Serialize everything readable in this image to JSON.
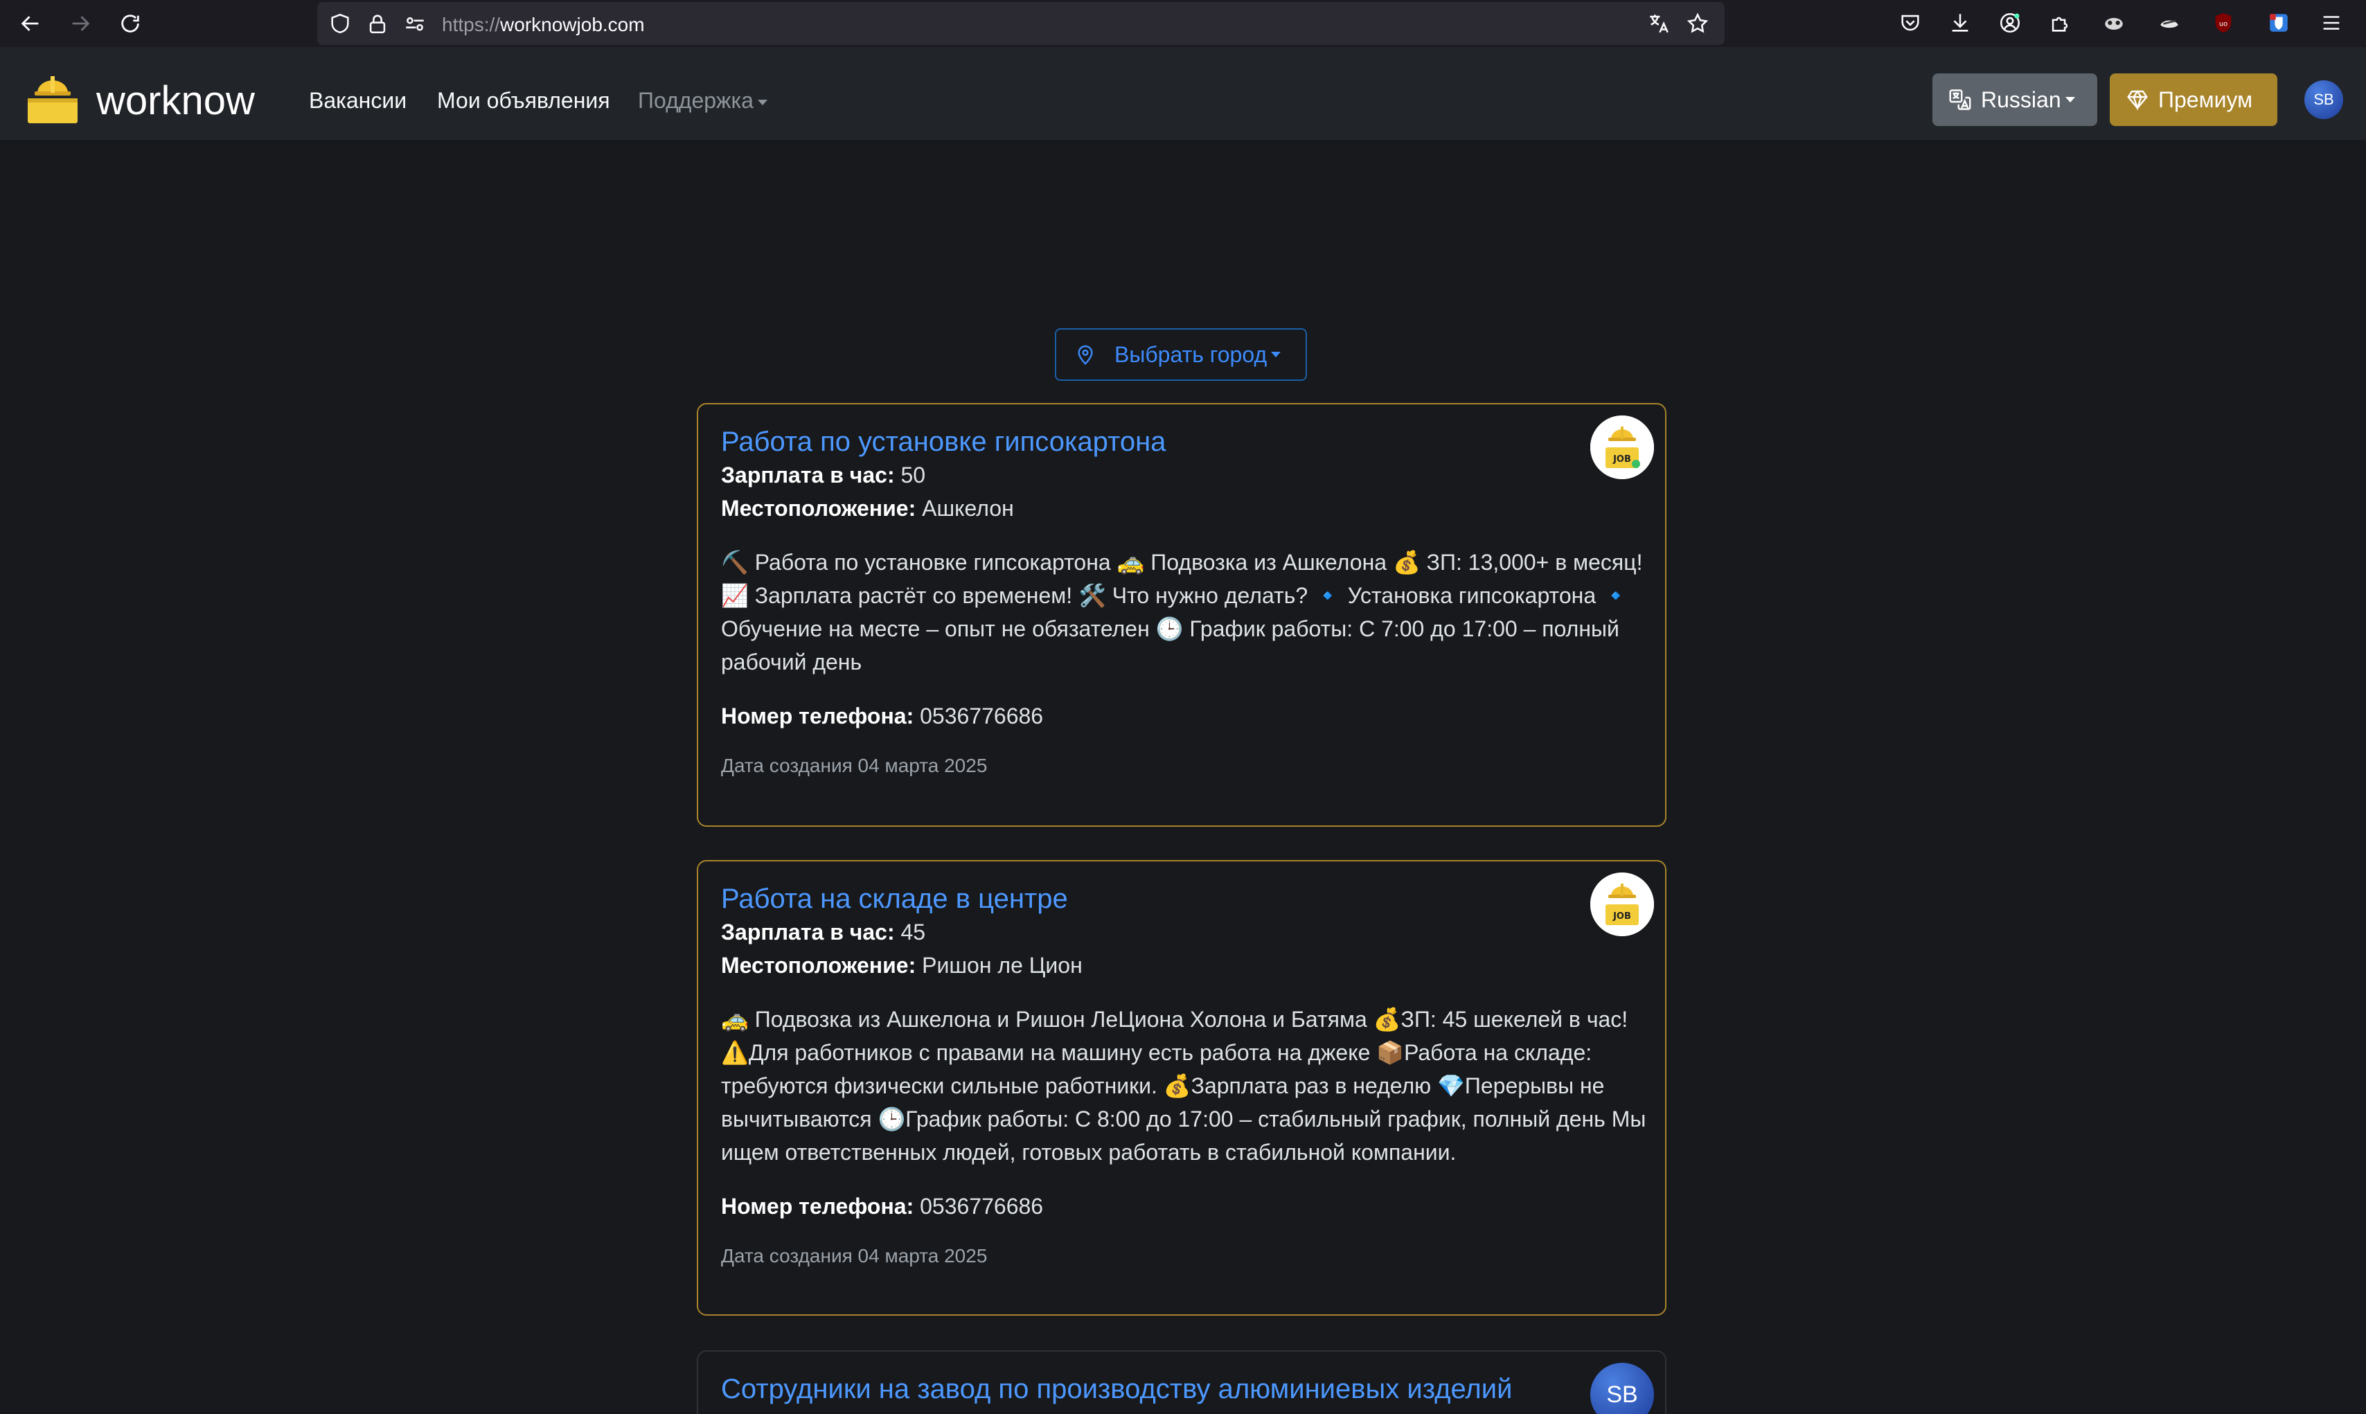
{
  "browser": {
    "url_scheme": "https://",
    "url_host": "worknowjob.com"
  },
  "navbar": {
    "brand": "worknow",
    "links": [
      "Вакансии",
      "Мои объявления",
      "Поддержка"
    ],
    "language_label": "Russian",
    "premium_label": "Премиум",
    "avatar_initials": "SB"
  },
  "city_selector": {
    "label": "Выбрать город"
  },
  "jobs": [
    {
      "title": "Работа по установке гипсокартона",
      "salary_label": "Зарплата в час:",
      "salary": "50",
      "location_label": "Местоположение:",
      "location": "Ашкелон",
      "description": "⛏️ Работа по установке гипсокартона 🚕 Подвозка из Ашкелона 💰 ЗП: 13,000+ в месяц! 📈 Зарплата растёт со временем! 🛠️ Что нужно делать? 🔹 Установка гипсокартона 🔹 Обучение на месте – опыт не обязателен 🕒 График работы: С 7:00 до 17:00 – полный рабочий день",
      "phone_label": "Номер телефона:",
      "phone": "0536776686",
      "date": "Дата создания 04 марта 2025"
    },
    {
      "title": "Работа на складе в центре",
      "salary_label": "Зарплата в час:",
      "salary": "45",
      "location_label": "Местоположение:",
      "location": "Ришон ле Цион",
      "description": "🚕 Подвозка из Ашкелона и Ришон ЛеЦиона Холона и Батяма 💰ЗП: 45 шекелей в час! ⚠️Для работников с правами на машину есть работа на джеке 📦Работа на складе: требуются физически сильные работники. 💰Зарплата раз в неделю 💎Перерывы не вычитываются 🕒График работы: С 8:00 до 17:00 – стабильный график, полный день Мы ищем ответственных людей, готовых работать в стабильной компании.",
      "phone_label": "Номер телефона:",
      "phone": "0536776686",
      "date": "Дата создания 04 марта 2025"
    },
    {
      "title": "Сотрудники на завод по производству алюминиевых изделий",
      "avatar_initials": "SB"
    }
  ]
}
